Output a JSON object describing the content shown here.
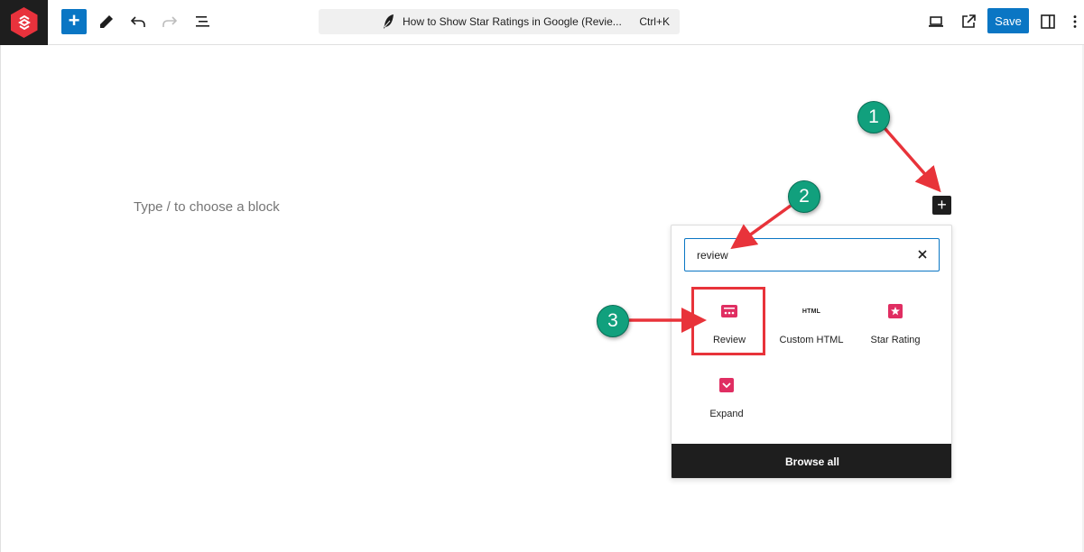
{
  "toolbar": {
    "add_block_label": "+",
    "document_title": "How to Show Star Ratings in Google (Revie...",
    "command_shortcut": "Ctrl+K",
    "save_label": "Save",
    "icons": [
      "wordpress-logo-icon",
      "plus-icon",
      "pencil-icon",
      "undo-icon",
      "redo-icon",
      "list-view-icon",
      "feather-icon",
      "desktop-preview-icon",
      "external-link-icon",
      "sidebar-toggle-icon",
      "options-kebab-icon"
    ]
  },
  "editor": {
    "placeholder": "Type / to choose a block",
    "inline_inserter_label": "+"
  },
  "inserter": {
    "search_value": "review",
    "blocks": [
      {
        "label": "Review",
        "icon": "review-block-icon"
      },
      {
        "label": "Custom HTML",
        "icon": "html-block-icon",
        "icon_text": "HTML"
      },
      {
        "label": "Star Rating",
        "icon": "star-rating-block-icon"
      },
      {
        "label": "Expand",
        "icon": "expand-block-icon"
      }
    ],
    "browse_all_label": "Browse all"
  },
  "annotations": {
    "steps": [
      "1",
      "2",
      "3"
    ]
  },
  "colors": {
    "accent": "#0a76c4",
    "block_icon": "#e02e62",
    "step_badge": "#11a07d",
    "arrow": "#e8333a",
    "dark": "#1e1e1e"
  }
}
